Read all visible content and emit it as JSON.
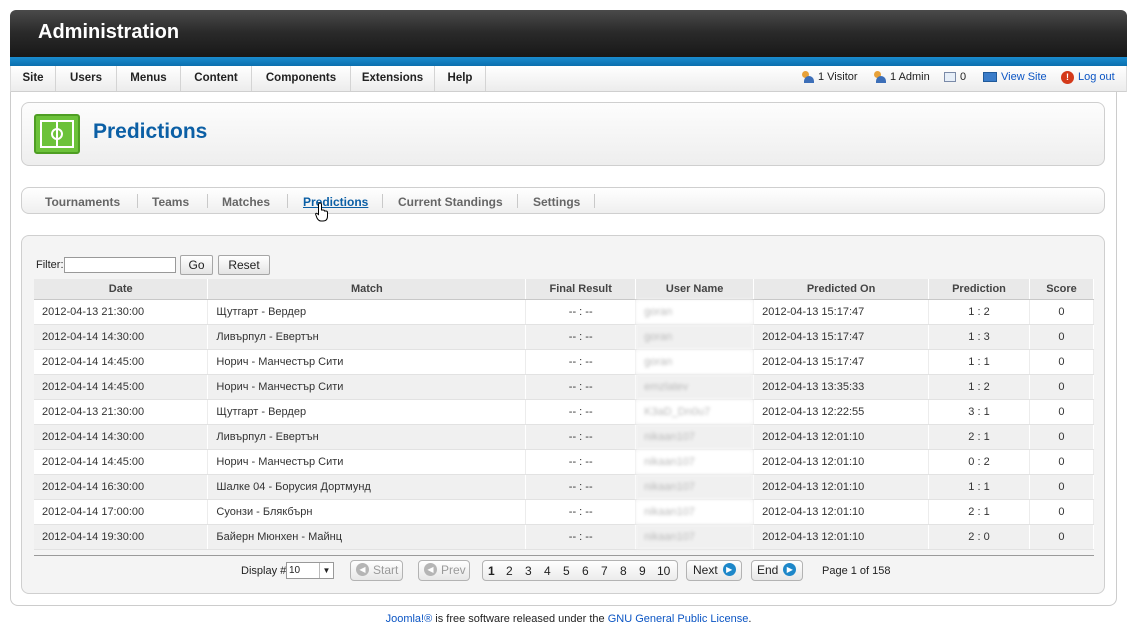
{
  "header": {
    "title": "Administration"
  },
  "menu": [
    {
      "label": "Site"
    },
    {
      "label": "Users"
    },
    {
      "label": "Menus"
    },
    {
      "label": "Content"
    },
    {
      "label": "Components"
    },
    {
      "label": "Extensions"
    },
    {
      "label": "Help"
    }
  ],
  "status": {
    "visitors": "1 Visitor",
    "admins": "1 Admin",
    "messages": "0",
    "view_site": "View Site",
    "logout": "Log out"
  },
  "page": {
    "title": "Predictions",
    "icon": "soccer-field-icon"
  },
  "tabs": [
    {
      "label": "Tournaments"
    },
    {
      "label": "Teams"
    },
    {
      "label": "Matches"
    },
    {
      "label": "Predictions",
      "active": true
    },
    {
      "label": "Current Standings"
    },
    {
      "label": "Settings"
    }
  ],
  "filter": {
    "label": "Filter:",
    "value": "",
    "go": "Go",
    "reset": "Reset"
  },
  "table": {
    "columns": [
      "Date",
      "Match",
      "Final Result",
      "User Name",
      "Predicted On",
      "Prediction",
      "Score"
    ],
    "rows": [
      {
        "date": "2012-04-13 21:30:00",
        "match": "Щутгарт - Вердер",
        "result": "-- : --",
        "user": "goran",
        "predicted_on": "2012-04-13 15:17:47",
        "prediction": "1 : 2",
        "score": "0"
      },
      {
        "date": "2012-04-14 14:30:00",
        "match": "Ливърпул - Евертън",
        "result": "-- : --",
        "user": "goran",
        "predicted_on": "2012-04-13 15:17:47",
        "prediction": "1 : 3",
        "score": "0"
      },
      {
        "date": "2012-04-14 14:45:00",
        "match": "Норич - Манчестър Сити",
        "result": "-- : --",
        "user": "goran",
        "predicted_on": "2012-04-13 15:17:47",
        "prediction": "1 : 1",
        "score": "0"
      },
      {
        "date": "2012-04-14 14:45:00",
        "match": "Норич - Манчестър Сити",
        "result": "-- : --",
        "user": "emzlatev",
        "predicted_on": "2012-04-13 13:35:33",
        "prediction": "1 : 2",
        "score": "0"
      },
      {
        "date": "2012-04-13 21:30:00",
        "match": "Щутгарт - Вердер",
        "result": "-- : --",
        "user": "K3aD_Dn0u7",
        "predicted_on": "2012-04-13 12:22:55",
        "prediction": "3 : 1",
        "score": "0"
      },
      {
        "date": "2012-04-14 14:30:00",
        "match": "Ливърпул - Евертън",
        "result": "-- : --",
        "user": "nikaan107",
        "predicted_on": "2012-04-13 12:01:10",
        "prediction": "2 : 1",
        "score": "0"
      },
      {
        "date": "2012-04-14 14:45:00",
        "match": "Норич - Манчестър Сити",
        "result": "-- : --",
        "user": "nikaan107",
        "predicted_on": "2012-04-13 12:01:10",
        "prediction": "0 : 2",
        "score": "0"
      },
      {
        "date": "2012-04-14 16:30:00",
        "match": "Шалке 04 - Борусия Дортмунд",
        "result": "-- : --",
        "user": "nikaan107",
        "predicted_on": "2012-04-13 12:01:10",
        "prediction": "1 : 1",
        "score": "0"
      },
      {
        "date": "2012-04-14 17:00:00",
        "match": "Суонзи - Блякбърн",
        "result": "-- : --",
        "user": "nikaan107",
        "predicted_on": "2012-04-13 12:01:10",
        "prediction": "2 : 1",
        "score": "0"
      },
      {
        "date": "2012-04-14 19:30:00",
        "match": "Байерн Мюнхен - Майнц",
        "result": "-- : --",
        "user": "nikaan107",
        "predicted_on": "2012-04-13 12:01:10",
        "prediction": "2 : 0",
        "score": "0"
      }
    ]
  },
  "pagination": {
    "display_label": "Display #",
    "display_value": "10",
    "start": "Start",
    "prev": "Prev",
    "pages": [
      "1",
      "2",
      "3",
      "4",
      "5",
      "6",
      "7",
      "8",
      "9",
      "10"
    ],
    "current_page": "1",
    "next": "Next",
    "end": "End",
    "page_info": "Page 1 of 158"
  },
  "footer": {
    "joomla": "Joomla!®",
    "text": " is free software released under the ",
    "license": "GNU General Public License",
    "tail": "."
  }
}
